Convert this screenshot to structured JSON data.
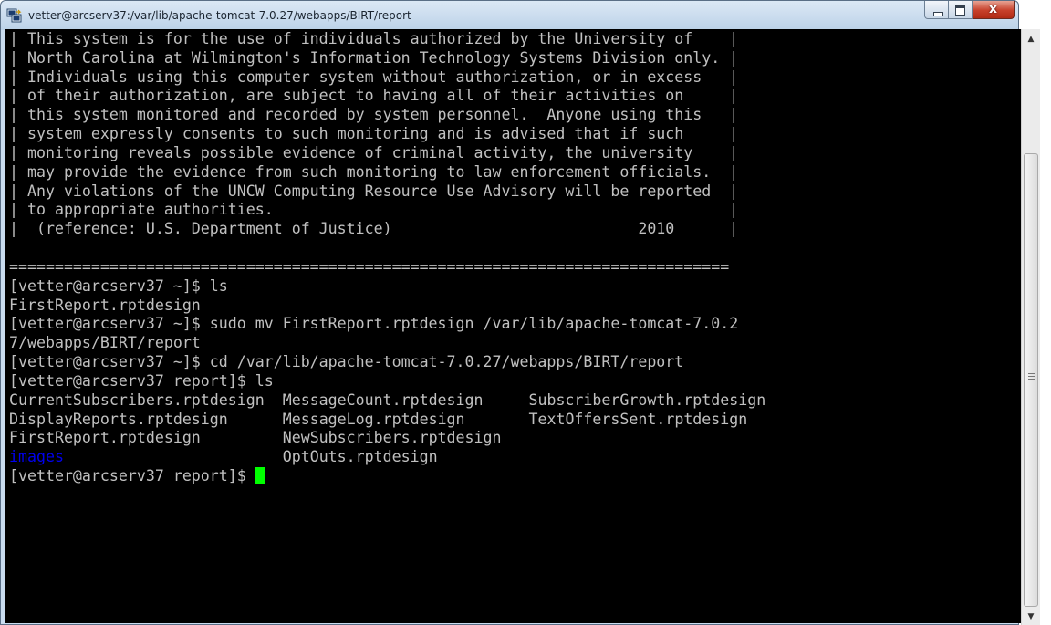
{
  "window": {
    "title": "vetter@arcserv37:/var/lib/apache-tomcat-7.0.27/webapps/BIRT/report",
    "icons": {
      "app": "putty-icon",
      "minimize": "minimize-icon",
      "maximize": "maximize-icon",
      "close": "close-icon"
    },
    "close_glyph": "x"
  },
  "terminal": {
    "colors": {
      "background": "#000000",
      "foreground": "#c0c0c0",
      "directory": "#0000ee",
      "cursor": "#00ff00"
    },
    "banner": [
      "| This system is for the use of individuals authorized by the University of    |",
      "| North Carolina at Wilmington's Information Technology Systems Division only. |",
      "| Individuals using this computer system without authorization, or in excess   |",
      "| of their authorization, are subject to having all of their activities on     |",
      "| this system monitored and recorded by system personnel.  Anyone using this   |",
      "| system expressly consents to such monitoring and is advised that if such     |",
      "| monitoring reveals possible evidence of criminal activity, the university    |",
      "| may provide the evidence from such monitoring to law enforcement officials.  |",
      "| Any violations of the UNCW Computing Resource Use Advisory will be reported  |",
      "| to appropriate authorities.                                                  |",
      "|  (reference: U.S. Department of Justice)                           2010      |",
      "",
      "==============================================================================="
    ],
    "session": [
      "[vetter@arcserv37 ~]$ ls",
      "FirstReport.rptdesign",
      "[vetter@arcserv37 ~]$ sudo mv FirstReport.rptdesign /var/lib/apache-tomcat-7.0.2",
      "7/webapps/BIRT/report",
      "[vetter@arcserv37 ~]$ cd /var/lib/apache-tomcat-7.0.27/webapps/BIRT/report",
      "[vetter@arcserv37 report]$ ls"
    ],
    "listing": [
      [
        "CurrentSubscribers.rptdesign",
        "MessageCount.rptdesign",
        "SubscriberGrowth.rptdesign"
      ],
      [
        "DisplayReports.rptdesign",
        "MessageLog.rptdesign",
        "TextOffersSent.rptdesign"
      ],
      [
        "FirstReport.rptdesign",
        "NewSubscribers.rptdesign",
        ""
      ],
      [
        "images",
        "OptOuts.rptdesign",
        ""
      ]
    ],
    "directories": [
      "images"
    ],
    "prompt": "[vetter@arcserv37 report]$ "
  },
  "scrollbar": {
    "up_glyph": "▲",
    "down_glyph": "▼",
    "icons": {
      "up": "scroll-up-arrow-icon",
      "down": "scroll-down-arrow-icon"
    }
  }
}
